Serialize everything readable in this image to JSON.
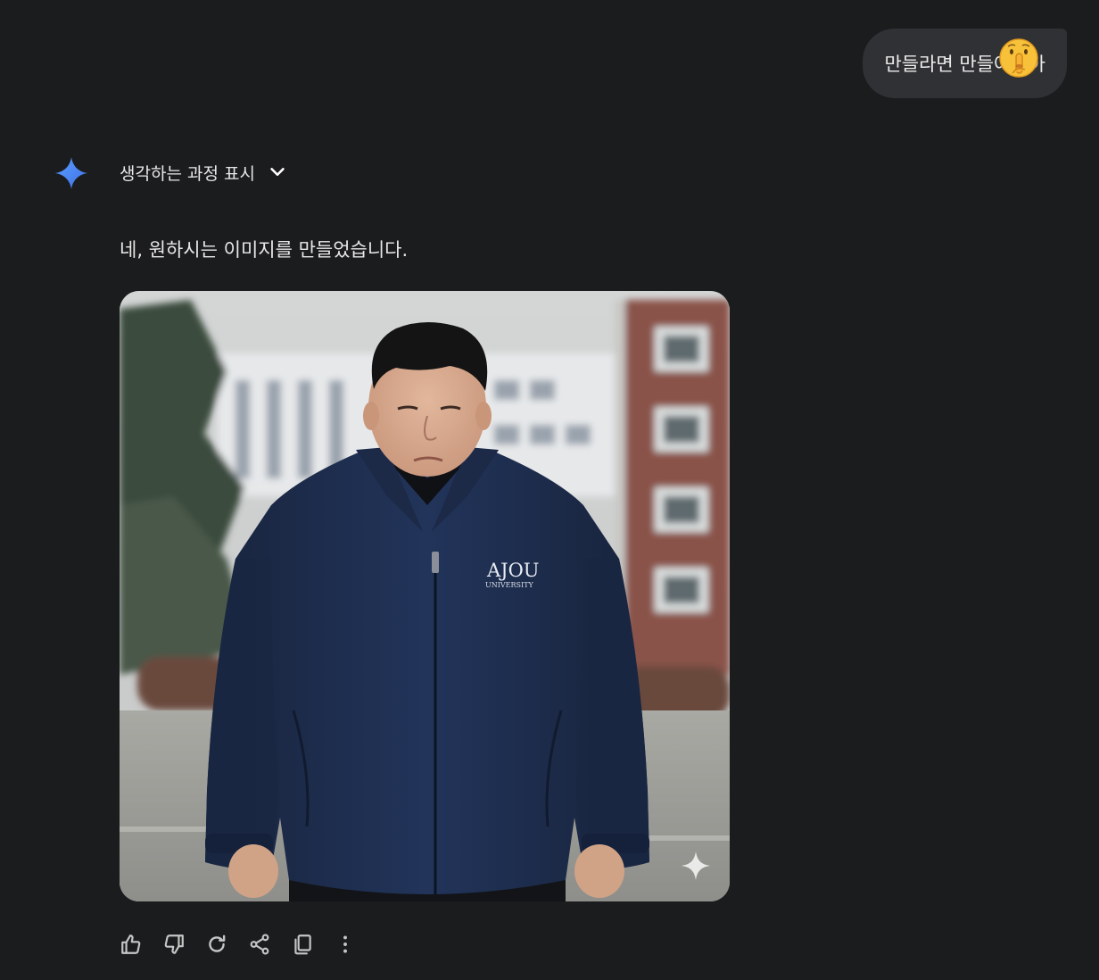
{
  "user_message": {
    "text_before": "만들라면 만들어 ",
    "text_after": "야아",
    "emoji": "shushing-face-emoji"
  },
  "assistant": {
    "avatar_icon": "gemini-sparkle-icon",
    "thinking_toggle_label": "생각하는 과정 표시",
    "response_text": "네, 원하시는 이미지를 만들었습니다.",
    "image": {
      "jacket_text_main": "AJOU",
      "jacket_text_sub": "UNIVERSITY",
      "watermark_icon": "sparkle-watermark-icon"
    },
    "actions": [
      "thumbs-up-icon",
      "thumbs-down-icon",
      "regenerate-icon",
      "share-icon",
      "copy-icon",
      "more-vert-icon"
    ]
  },
  "colors": {
    "background": "#1b1c1e",
    "bubble": "#303134",
    "gemini_blue": "#4b8df8",
    "jacket_navy": "#1e2d4a"
  }
}
